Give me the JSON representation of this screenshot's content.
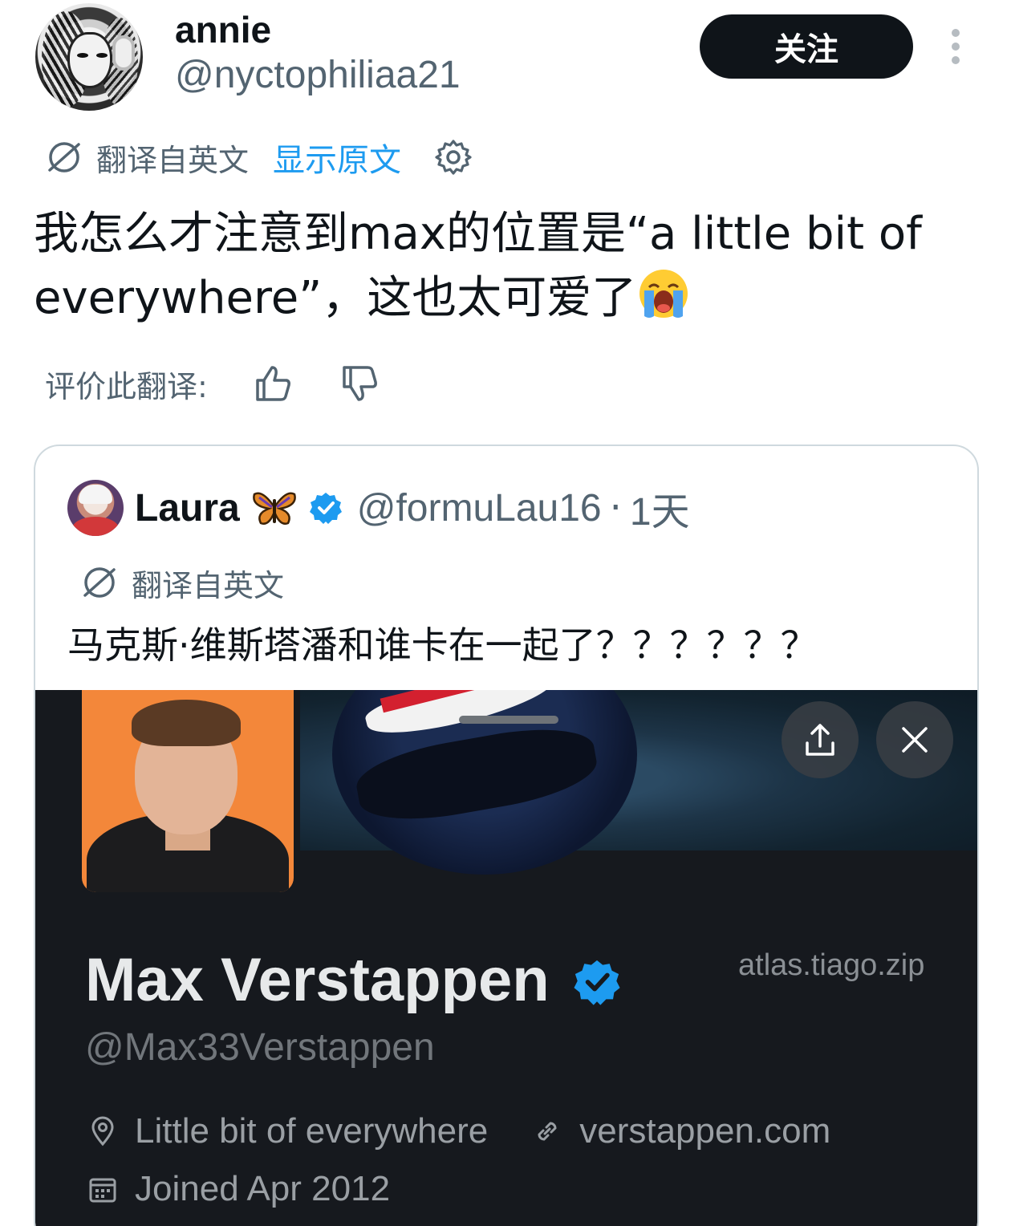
{
  "tweet": {
    "display_name": "annie",
    "handle": "@nyctophiliaa21",
    "follow_label": "关注",
    "translated_label": "翻译自英文",
    "show_original_label": "显示原文",
    "text": "我怎么才注意到max的位置是“a little bit of everywhere”，这也太可爱了",
    "emoji": "loudly-crying-face-emoji",
    "rate_label": "评价此翻译:"
  },
  "quote": {
    "display_name": "Laura",
    "handle": "@formuLau16",
    "separator": "·",
    "time": "1天",
    "translated_label": "翻译自英文",
    "text": "马克斯·维斯塔潘和谁卡在一起了？？？？？？",
    "embedded_profile": {
      "name": "Max Verstappen",
      "handle": "@Max33Verstappen",
      "watermark": "atlas.tiago.zip",
      "location": "Little bit of everywhere",
      "website": "verstappen.com",
      "joined": "Joined Apr 2012"
    }
  },
  "colors": {
    "accent": "#1d9bf0",
    "secondary_text": "#536471",
    "follow_bg": "#0f1419",
    "embedded_bg": "#16191e"
  }
}
